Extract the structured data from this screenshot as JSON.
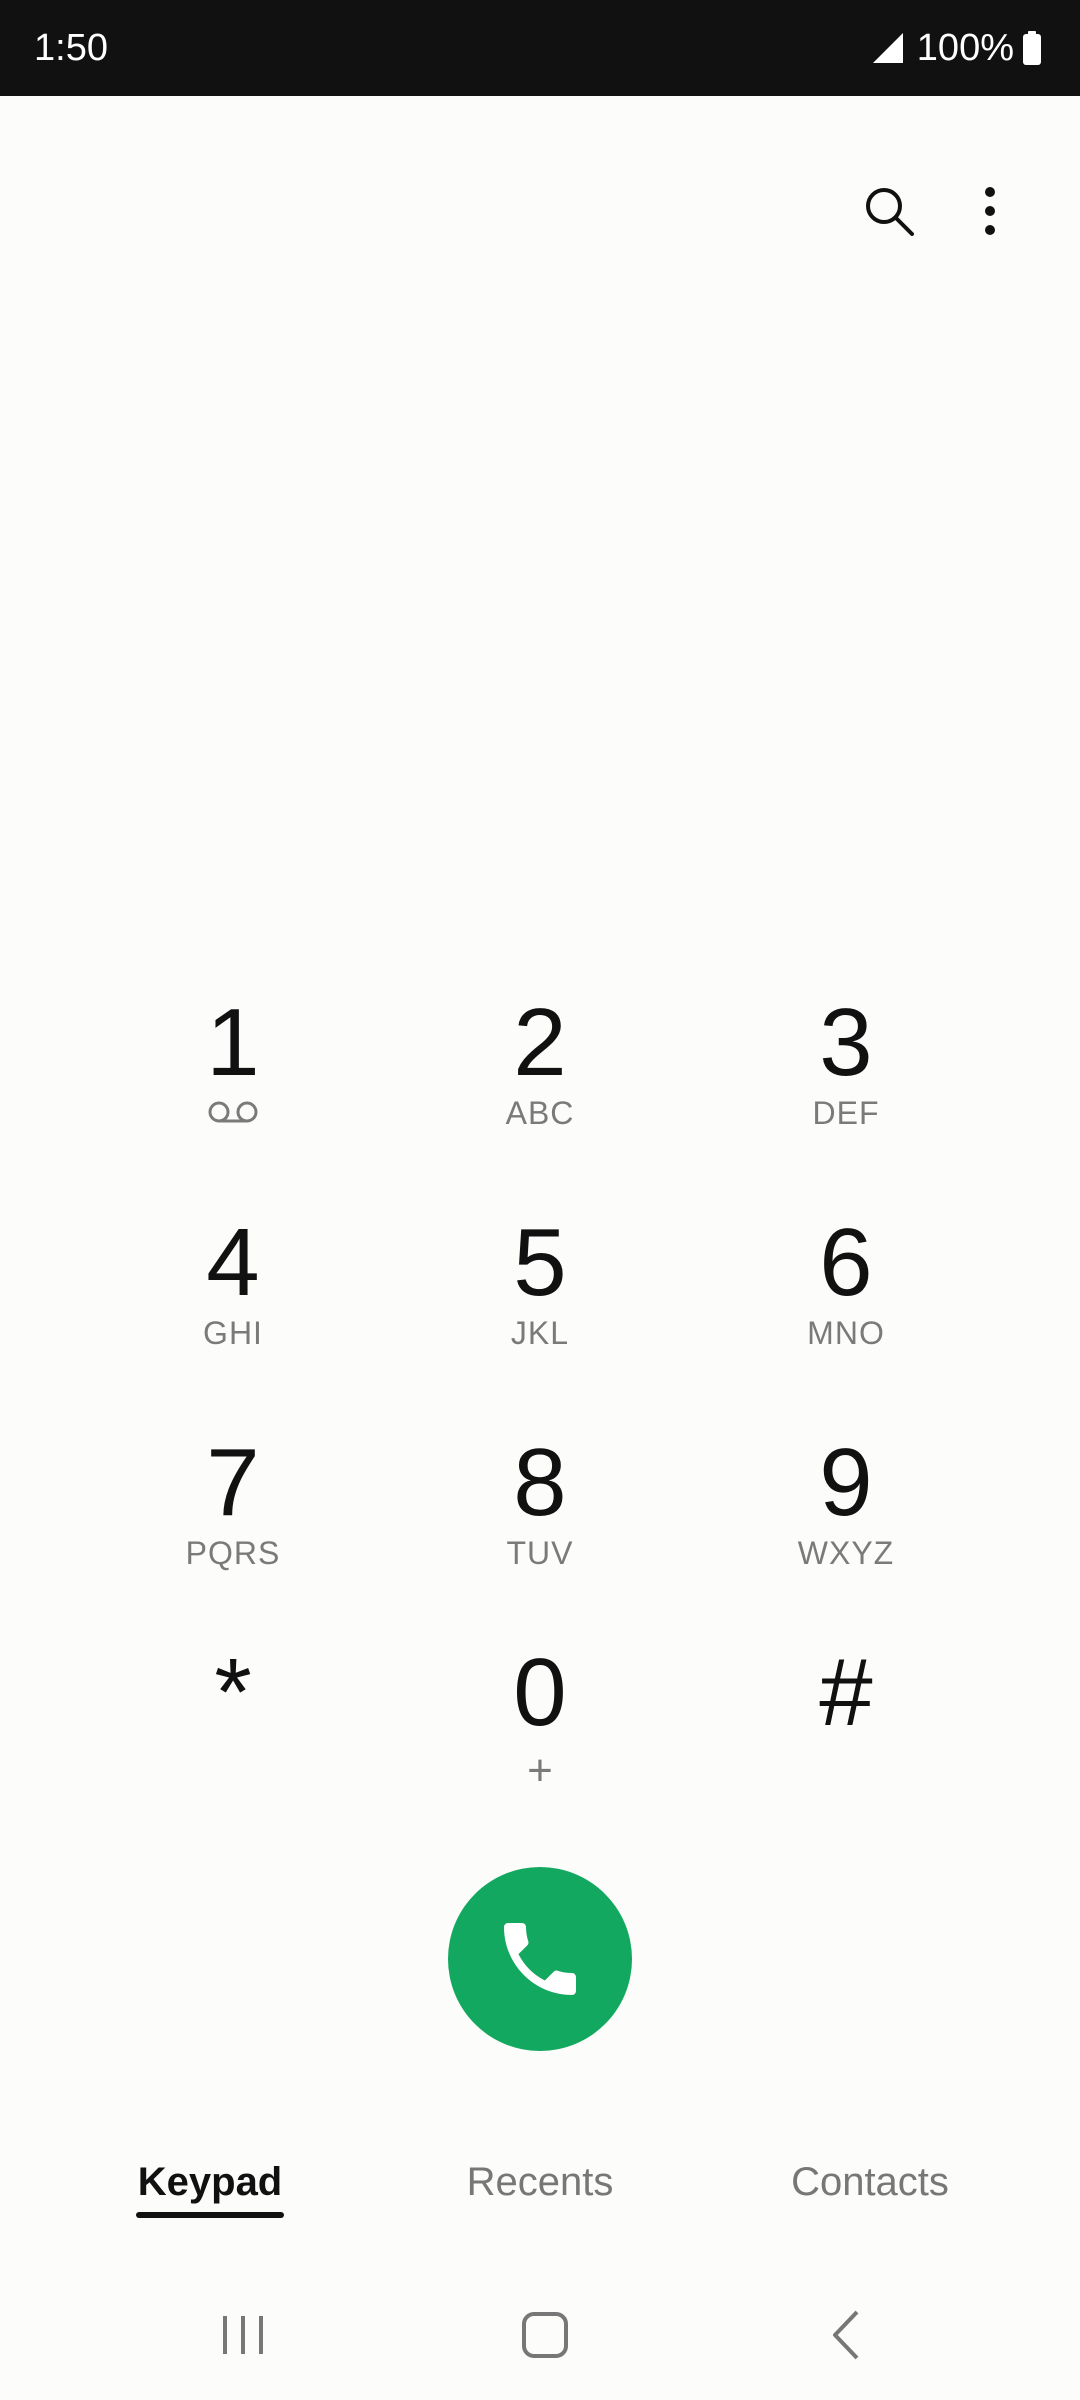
{
  "status_bar": {
    "time": "1:50",
    "battery": "100%"
  },
  "toolbar": {
    "search_icon": "search-icon",
    "more_icon": "more-vert-icon"
  },
  "keypad": {
    "keys": [
      {
        "digit": "1",
        "letters": "",
        "icon": "voicemail-icon"
      },
      {
        "digit": "2",
        "letters": "ABC"
      },
      {
        "digit": "3",
        "letters": "DEF"
      },
      {
        "digit": "4",
        "letters": "GHI"
      },
      {
        "digit": "5",
        "letters": "JKL"
      },
      {
        "digit": "6",
        "letters": "MNO"
      },
      {
        "digit": "7",
        "letters": "PQRS"
      },
      {
        "digit": "8",
        "letters": "TUV"
      },
      {
        "digit": "9",
        "letters": "WXYZ"
      },
      {
        "digit": "*",
        "letters": ""
      },
      {
        "digit": "0",
        "letters": "+"
      },
      {
        "digit": "#",
        "letters": ""
      }
    ]
  },
  "call_button": {
    "icon": "phone-icon",
    "color": "#12a85f"
  },
  "tabs": [
    {
      "label": "Keypad",
      "active": true
    },
    {
      "label": "Recents",
      "active": false
    },
    {
      "label": "Contacts",
      "active": false
    }
  ],
  "navbar": {
    "recents_icon": "recent-apps-icon",
    "home_icon": "home-icon",
    "back_icon": "back-icon"
  }
}
